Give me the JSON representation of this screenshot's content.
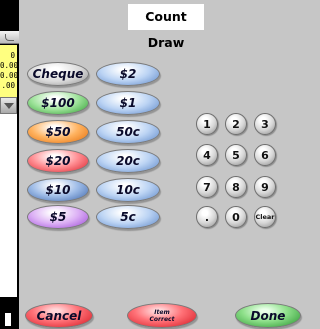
{
  "title": "Count Draw",
  "side_panel": {
    "values": [
      "0",
      "0.00",
      "0.00",
      ".00"
    ]
  },
  "denominations_left": [
    {
      "label": "Cheque",
      "color": "silver"
    },
    {
      "label": "$100",
      "color": "green"
    },
    {
      "label": "$50",
      "color": "orange"
    },
    {
      "label": "$20",
      "color": "red"
    },
    {
      "label": "$10",
      "color": "dblue"
    },
    {
      "label": "$5",
      "color": "purple"
    }
  ],
  "denominations_right": [
    {
      "label": "$2"
    },
    {
      "label": "$1"
    },
    {
      "label": "50c"
    },
    {
      "label": "20c"
    },
    {
      "label": "10c"
    },
    {
      "label": "5c"
    }
  ],
  "keypad": [
    "1",
    "2",
    "3",
    "4",
    "5",
    "6",
    "7",
    "8",
    "9",
    ".",
    "0",
    "Clear"
  ],
  "footer": {
    "cancel": "Cancel",
    "item_correct_line1": "Item",
    "item_correct_line2": "Correct",
    "done": "Done"
  },
  "colors": {
    "background": "#c6c6c6",
    "side_panel": "#ffff80"
  }
}
